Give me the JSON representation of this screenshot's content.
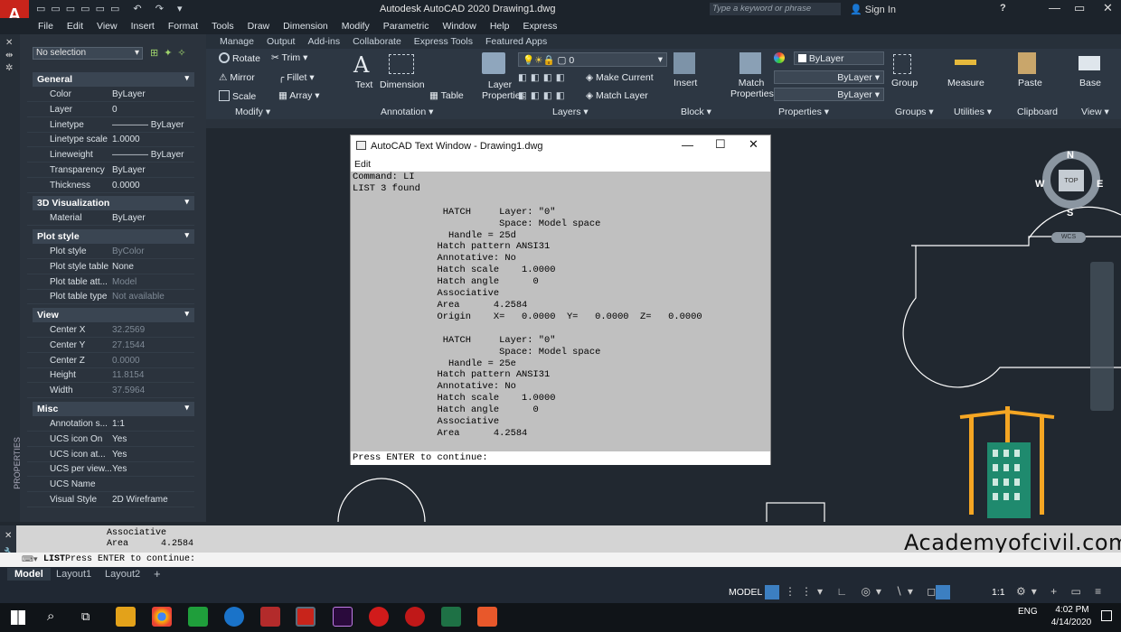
{
  "app": {
    "title": "Autodesk AutoCAD 2020   Drawing1.dwg",
    "search_placeholder": "Type a keyword or phrase",
    "sign_in": "Sign In"
  },
  "menu": [
    "File",
    "Edit",
    "View",
    "Insert",
    "Format",
    "Tools",
    "Draw",
    "Dimension",
    "Modify",
    "Parametric",
    "Window",
    "Help",
    "Express"
  ],
  "ribbon": {
    "tabs": [
      "Manage",
      "Output",
      "Add-ins",
      "Collaborate",
      "Express Tools",
      "Featured Apps"
    ],
    "modify": {
      "rotate": "Rotate",
      "trim": "Trim",
      "mirror": "Mirror",
      "fillet": "Fillet",
      "scale": "Scale",
      "array": "Array",
      "panel": "Modify ▾"
    },
    "annotation": {
      "text": "Text",
      "dimension": "Dimension",
      "table": "Table",
      "panel": "Annotation ▾"
    },
    "layers": {
      "properties": "Layer Properties",
      "current_layer": "0",
      "make_current": "Make Current",
      "match_layer": "Match Layer",
      "panel": "Layers ▾"
    },
    "block": {
      "insert": "Insert",
      "panel": "Block ▾"
    },
    "properties": {
      "match": "Match Properties",
      "bylayer1": "ByLayer",
      "bylayer2": "ByLayer",
      "bylayer3": "ByLayer",
      "panel": "Properties ▾"
    },
    "groups": {
      "group": "Group",
      "panel": "Groups ▾"
    },
    "utilities": {
      "measure": "Measure",
      "panel": "Utilities ▾"
    },
    "clipboard": {
      "paste": "Paste",
      "panel": "Clipboard"
    },
    "view": {
      "base": "Base",
      "panel": "View ▾"
    }
  },
  "props": {
    "selection": "No selection",
    "sections": {
      "general": "General",
      "vis3d": "3D Visualization",
      "plot": "Plot style",
      "view": "View",
      "misc": "Misc"
    },
    "general": [
      {
        "k": "Color",
        "v": "ByLayer"
      },
      {
        "k": "Layer",
        "v": "0"
      },
      {
        "k": "Linetype",
        "v": "———— ByLayer"
      },
      {
        "k": "Linetype scale",
        "v": "1.0000"
      },
      {
        "k": "Lineweight",
        "v": "———— ByLayer"
      },
      {
        "k": "Transparency",
        "v": "ByLayer"
      },
      {
        "k": "Thickness",
        "v": "0.0000"
      }
    ],
    "vis3d": [
      {
        "k": "Material",
        "v": "ByLayer"
      }
    ],
    "plot": [
      {
        "k": "Plot style",
        "v": "ByColor"
      },
      {
        "k": "Plot style table",
        "v": "None"
      },
      {
        "k": "Plot table att...",
        "v": "Model"
      },
      {
        "k": "Plot table type",
        "v": "Not available"
      }
    ],
    "view": [
      {
        "k": "Center X",
        "v": "32.2569"
      },
      {
        "k": "Center Y",
        "v": "27.1544"
      },
      {
        "k": "Center Z",
        "v": "0.0000"
      },
      {
        "k": "Height",
        "v": "11.8154"
      },
      {
        "k": "Width",
        "v": "37.5964"
      }
    ],
    "misc": [
      {
        "k": "Annotation s...",
        "v": "1:1"
      },
      {
        "k": "UCS icon On",
        "v": "Yes"
      },
      {
        "k": "UCS icon at...",
        "v": "Yes"
      },
      {
        "k": "UCS per view...",
        "v": "Yes"
      },
      {
        "k": "UCS Name",
        "v": ""
      },
      {
        "k": "Visual Style",
        "v": "2D Wireframe"
      }
    ],
    "side_label": "PROPERTIES"
  },
  "textwin": {
    "title": "AutoCAD Text Window - Drawing1.dwg",
    "menu": "Edit",
    "body": "Command: LI\nLIST 3 found\n\n                HATCH     Layer: \"0\"\n                          Space: Model space\n                 Handle = 25d\n               Hatch pattern ANSI31\n               Annotative: No\n               Hatch scale    1.0000\n               Hatch angle      0\n               Associative\n               Area      4.2584\n               Origin    X=   0.0000  Y=   0.0000  Z=   0.0000\n\n                HATCH     Layer: \"0\"\n                          Space: Model space\n                 Handle = 25e\n               Hatch pattern ANSI31\n               Annotative: No\n               Hatch scale    1.0000\n               Hatch angle      0\n               Associative\n               Area      4.2584",
    "prompt": "Press ENTER to continue:"
  },
  "viewcube": {
    "n": "N",
    "s": "S",
    "e": "E",
    "w": "W",
    "top": "TOP",
    "wcs": "WCS"
  },
  "cmd": {
    "history": "Associative\nArea      4.2584",
    "line_cmd": "LIST",
    "line_text": " Press ENTER to continue:"
  },
  "layouts": [
    "Model",
    "Layout1",
    "Layout2"
  ],
  "status": {
    "model": "MODEL",
    "scale": "1:1"
  },
  "taskbar": {
    "lang": "ENG",
    "time": "4:02 PM",
    "date": "4/14/2020"
  },
  "watermark": "Academyofcivil.com",
  "colors": {
    "accent": "#3c7fc1",
    "autocad_red": "#c8241b",
    "canvas": "#212830"
  }
}
